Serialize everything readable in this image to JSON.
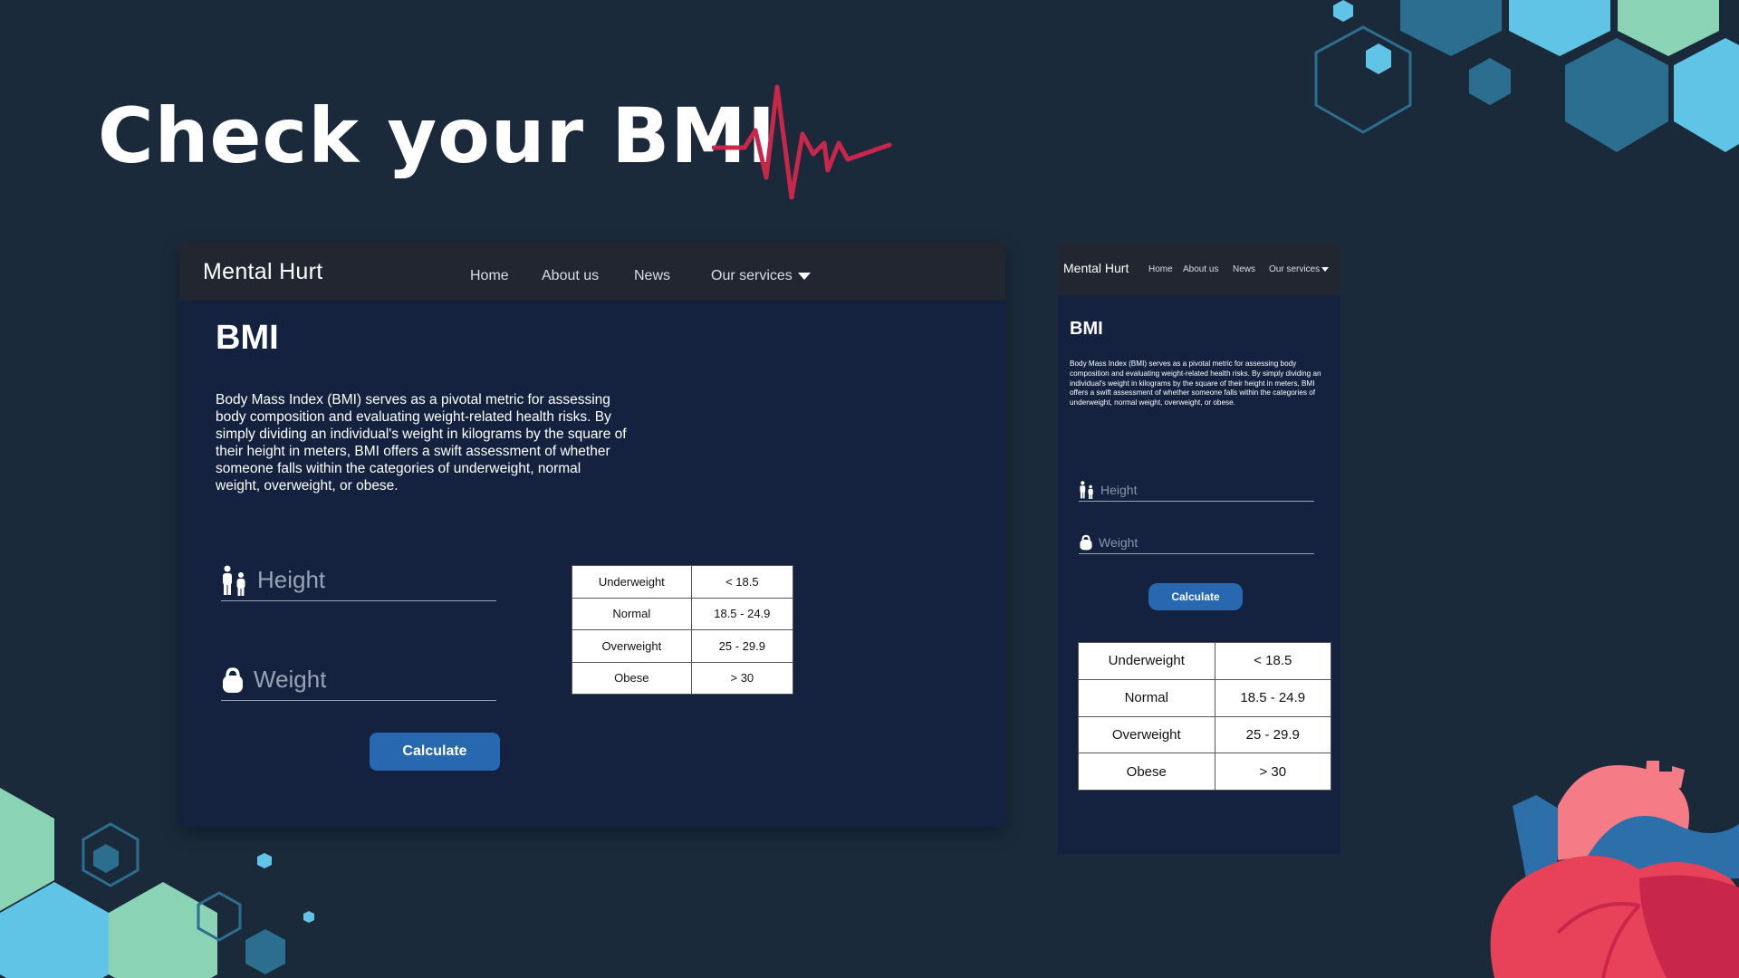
{
  "slide": {
    "title": "Check your BMI",
    "heartbeat_color": "#c8264a",
    "background": "#1b2a3b"
  },
  "desktop": {
    "brand": "Mental Hurt",
    "nav": [
      "Home",
      "About us",
      "News",
      "Our services"
    ],
    "heading": "BMI",
    "description": "Body Mass Index (BMI) serves as a pivotal metric for assessing body composition and evaluating weight-related health risks. By simply dividing an individual's weight in kilograms by the square of their height in meters, BMI offers a swift assessment of whether someone falls within the categories of underweight, normal weight, overweight, or obese.",
    "height_placeholder": "Height",
    "weight_placeholder": "Weight",
    "height_icon": "people-icon",
    "weight_icon": "kettlebell-icon",
    "calculate_label": "Calculate",
    "table": [
      [
        "Underweight",
        "< 18.5"
      ],
      [
        "Normal",
        "18.5 - 24.9"
      ],
      [
        "Overweight",
        "25 - 29.9"
      ],
      [
        "Obese",
        "> 30"
      ]
    ]
  },
  "mobile": {
    "brand": "Mental Hurt",
    "nav": [
      "Home",
      "About us",
      "News",
      "Our services"
    ],
    "heading": "BMI",
    "description": "Body Mass Index (BMI) serves as a pivotal metric for assessing body composition and evaluating weight-related health risks. By simply dividing an individual's weight in kilograms by the square of their height in meters, BMI offers a swift assessment of whether someone falls within the categories of underweight, normal weight, overweight, or obese.",
    "height_placeholder": "Height",
    "weight_placeholder": "Weight",
    "calculate_label": "Calculate",
    "table": [
      [
        "Underweight",
        "< 18.5"
      ],
      [
        "Normal",
        "18.5 - 24.9"
      ],
      [
        "Overweight",
        "25 - 29.9"
      ],
      [
        "Obese",
        "> 30"
      ]
    ]
  },
  "colors": {
    "accent_button": "#2768b0",
    "navbar": "#222631",
    "panel": "#14223f",
    "hex_light_blue": "#5fc4e6",
    "hex_mint": "#8ad3b4",
    "hex_teal": "#2b6e8f",
    "heart_red": "#e8425a",
    "heart_pink": "#f57b86",
    "heart_blue": "#2d6fa8"
  }
}
